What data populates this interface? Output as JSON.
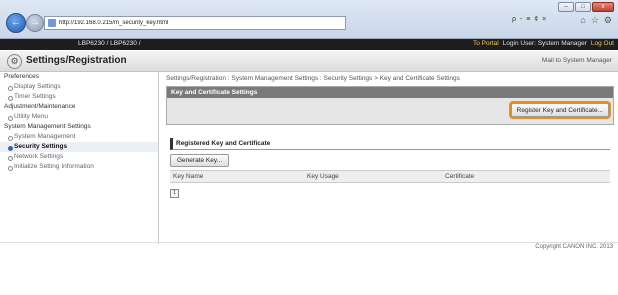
{
  "browser": {
    "url": "http://192.168.0.215/m_security_key.html",
    "address_controls": "ρ - ≡ ¢ ×",
    "window_controls": [
      "–",
      "□",
      "x"
    ]
  },
  "topbar": {
    "model": "LBP6230 / LBP6230 /",
    "portal_link": "To Portal",
    "login_user": "Login User: System Manager",
    "logout_link": "Log Out"
  },
  "header": {
    "title": "Settings/Registration",
    "mail_link": "Mail to System Manager"
  },
  "sidebar": {
    "items": [
      {
        "label": "Preferences",
        "type": "head"
      },
      {
        "label": "Display Settings",
        "type": "sub"
      },
      {
        "label": "Timer Settings",
        "type": "sub"
      },
      {
        "label": "Adjustment/Maintenance",
        "type": "head"
      },
      {
        "label": "Utility Menu",
        "type": "sub"
      },
      {
        "label": "System Management Settings",
        "type": "head"
      },
      {
        "label": "System Management",
        "type": "sub"
      },
      {
        "label": "Security Settings",
        "type": "sub",
        "active": true
      },
      {
        "label": "Network Settings",
        "type": "sub"
      },
      {
        "label": "Initialize Setting Information",
        "type": "sub"
      }
    ]
  },
  "main": {
    "breadcrumb": "Settings/Registration : System Management Settings : Security Settings > Key and Certificate Settings",
    "panel_title": "Key and Certificate Settings",
    "register_button": "Register Key and Certificate...",
    "section_title": "Registered Key and Certificate",
    "generate_button": "Generate Key...",
    "table_columns": [
      "Key Name",
      "Key Usage",
      "Certificate"
    ],
    "page_control": "1"
  },
  "footer": {
    "copyright": "Copyright CANON INC. 2013"
  }
}
